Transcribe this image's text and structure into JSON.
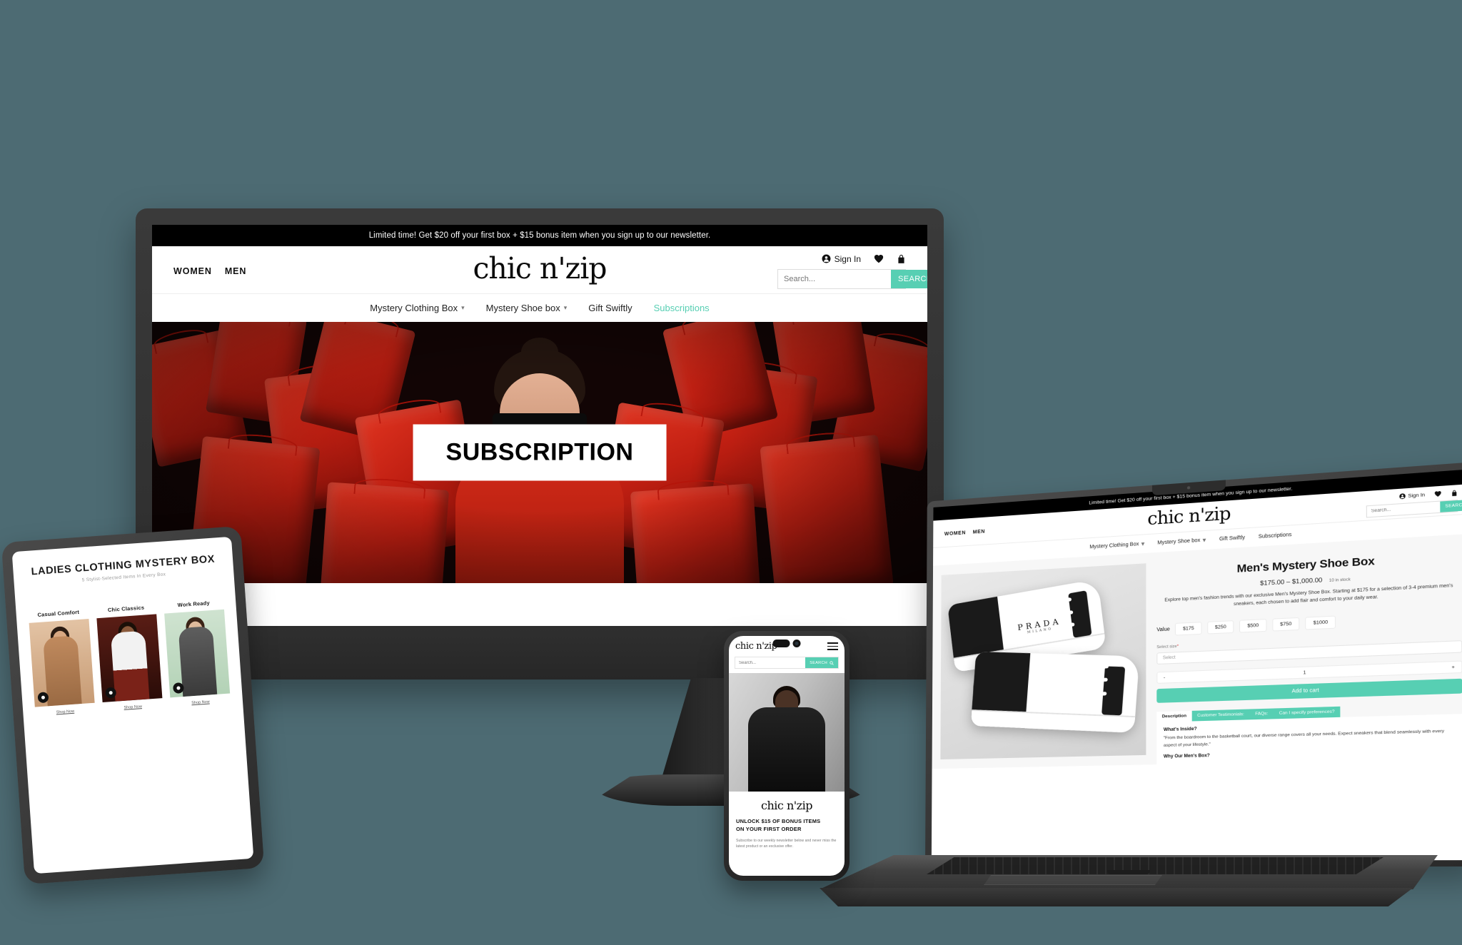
{
  "brand": {
    "name": "chic n'zip",
    "accent": "#57cfb3",
    "page_bg": "#4d6b73"
  },
  "promo": {
    "text": "Limited time! Get $20 off your first box + $15 bonus item when you sign up to our newsletter."
  },
  "header": {
    "left_links": [
      "WOMEN",
      "MEN"
    ],
    "logo": "chic n'zip",
    "signin": "Sign In",
    "icons": [
      "account-icon",
      "heart-icon",
      "bag-icon"
    ],
    "search": {
      "placeholder": "Search...",
      "button": "SEARCH"
    }
  },
  "nav": {
    "items": [
      {
        "label": "Mystery Clothing Box",
        "caret": true,
        "active": false
      },
      {
        "label": "Mystery Shoe box",
        "caret": true,
        "active": false
      },
      {
        "label": "Gift Swiftly",
        "caret": false,
        "active": false
      },
      {
        "label": "Subscriptions",
        "caret": false,
        "active": true
      }
    ]
  },
  "hero": {
    "banner_text": "SUBSCRIPTION"
  },
  "tablet": {
    "title": "LADIES CLOTHING MYSTERY BOX",
    "subtitle": "5 Stylist-Selected Items In Every Box",
    "cards": [
      {
        "title": "Casual Comfort",
        "cta": "Shop Now"
      },
      {
        "title": "Chic Classics",
        "cta": "Shop Now"
      },
      {
        "title": "Work Ready",
        "cta": "Shop Now"
      }
    ]
  },
  "phone": {
    "logo": "chic n'zip",
    "search": {
      "placeholder": "Search...",
      "button": "SEARCH"
    },
    "footer_logo": "chic n'zip",
    "headline_line1": "UNLOCK $15 OF BONUS ITEMS",
    "headline_line2": "ON YOUR FIRST ORDER",
    "body": "Subscribe to our weekly newsletter below and never miss the latest product or an exclusive offer."
  },
  "laptop": {
    "promo": "Limited time! Get $20 off your first box + $15 bonus item when you sign up to our newsletter.",
    "header": {
      "left_links": [
        "WOMEN",
        "MEN"
      ],
      "logo": "chic n'zip",
      "signin": "Sign In",
      "search": {
        "placeholder": "Search...",
        "button": "SEARCH"
      }
    },
    "nav": [
      {
        "label": "Mystery Clothing Box",
        "caret": true
      },
      {
        "label": "Mystery Shoe box",
        "caret": true
      },
      {
        "label": "Gift Swiftly",
        "caret": false
      },
      {
        "label": "Subscriptions",
        "caret": false
      }
    ],
    "product": {
      "title": "Men's Mystery Shoe Box",
      "price": "$175.00 – $1,000.00",
      "stock": "10 in stock",
      "description": "Explore top men's fashion trends with our exclusive Men's Mystery Shoe Box. Starting at  $175 for a selection of 3-4 premium men's sneakers, each chosen to add flair and comfort to your daily wear.",
      "value_label": "Value",
      "value_options": [
        "$175",
        "$250",
        "$500",
        "$750",
        "$1000"
      ],
      "size_label": "Select size",
      "size_required": "*",
      "size_placeholder": "Select",
      "qty_minus": "-",
      "qty_value": "1",
      "qty_plus": "+",
      "add_to_cart": "Add to cart",
      "tabs": [
        "Description",
        "Customer Testimonials:",
        "FAQs:",
        "Can I specify preferences?"
      ],
      "active_tab": "Description",
      "tab_heading": "What's Inside?",
      "tab_body": "\"From the boardroom to the basketball court, our diverse range covers all your needs. Expect sneakers that blend seamlessly with every aspect of your lifestyle.\"",
      "tab_subheading": "Why Our Men's Box?",
      "shoe_brand": "PRADA",
      "shoe_brand_sub": "MILANO"
    }
  }
}
